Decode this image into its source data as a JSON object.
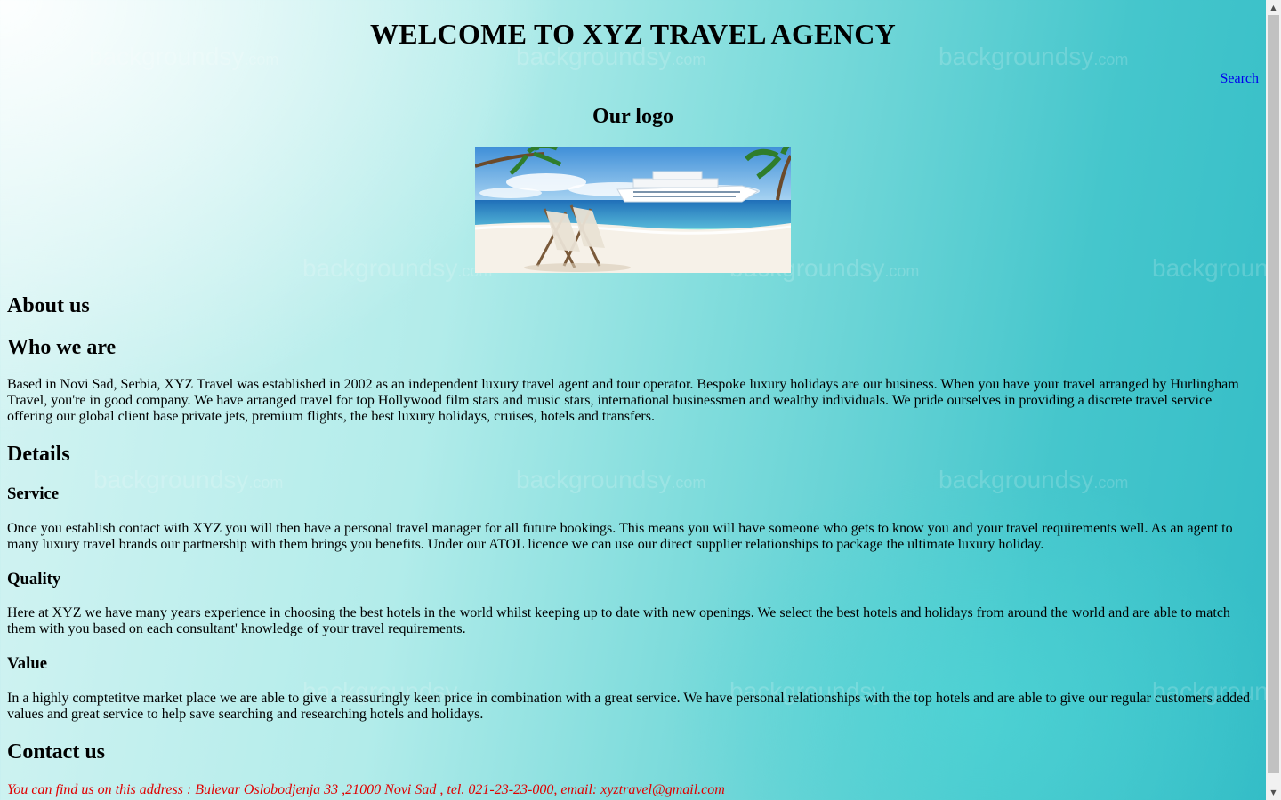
{
  "header": {
    "title": "WELCOME TO XYZ TRAVEL AGENCY",
    "search_link": "Search"
  },
  "logo": {
    "heading": "Our logo",
    "image_description": "beach-cruise-ship-image"
  },
  "watermark": {
    "brand": "backgroundsy",
    "suffix": ".com"
  },
  "about": {
    "heading": "About us",
    "subheading": "Who we are",
    "text": "Based in Novi Sad, Serbia, XYZ Travel was established in 2002 as an independent luxury travel agent and tour operator. Bespoke luxury holidays are our business. When you have your travel arranged by Hurlingham Travel, you're in good company. We have arranged travel for top Hollywood film stars and music stars, international businessmen and wealthy individuals. We pride ourselves in providing a discrete travel service offering our global client base private jets, premium flights, the best luxury holidays, cruises, hotels and transfers."
  },
  "details": {
    "heading": "Details",
    "service": {
      "heading": "Service",
      "text": "Once you establish contact with XYZ you will then have a personal travel manager for all future bookings. This means you will have someone who gets to know you and your travel requirements well. As an agent to many luxury travel brands our partnership with them brings you benefits. Under our ATOL licence we can use our direct supplier relationships to package the ultimate luxury holiday."
    },
    "quality": {
      "heading": "Quality",
      "text": "Here at XYZ we have many years experience in choosing the best hotels in the world whilst keeping up to date with new openings. We select the best hotels and holidays from around the world and are able to match them with you based on each consultant' knowledge of your travel requirements."
    },
    "value": {
      "heading": "Value",
      "text": "In a highly comptetitve market place we are able to give a reassuringly keen price in combination with a great service. We have personal relationships with the top hotels and are able to give our regular customers added values and great service to help save searching and researching hotels and holidays."
    }
  },
  "contact": {
    "heading": "Contact us",
    "address": "You can find us on this address : Bulevar Oslobodjenja 33 ,21000 Novi Sad , tel. 021-23-23-000, email: xyztravel@gmail.com"
  },
  "colors": {
    "link": "#0000ee",
    "address_text": "#e00000",
    "background_light": "#d6f4f3",
    "background_dark": "#32bcc6"
  },
  "icons": {
    "scroll_up": "triangle-up-icon",
    "scroll_down": "triangle-down-icon"
  }
}
